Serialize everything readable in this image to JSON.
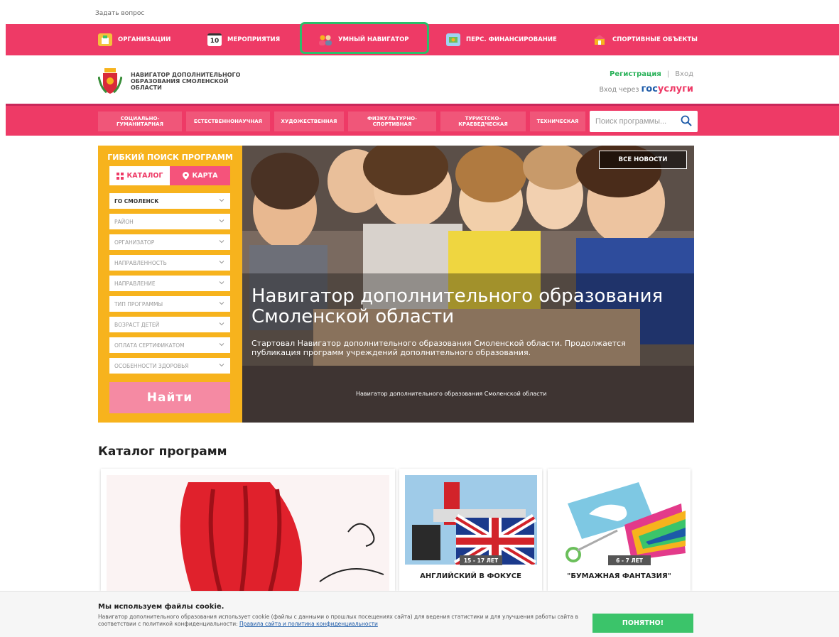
{
  "top_bar": {
    "ask_question": "Задать вопрос"
  },
  "top_nav": {
    "items": [
      {
        "label": "Организации",
        "icon": "building-icon"
      },
      {
        "label": "Мероприятия",
        "icon": "calendar-icon",
        "icon_text": "10"
      },
      {
        "label": "Умный навигатор",
        "icon": "people-icon"
      },
      {
        "label": "Перс. финансирование",
        "icon": "money-icon"
      },
      {
        "label": "Спортивные объекты",
        "icon": "sport-icon"
      }
    ],
    "highlight_color": "#2bbf6a"
  },
  "header": {
    "logo_text": "Навигатор дополнительного образования Смоленской области",
    "register": "Регистрация",
    "separator": "|",
    "login": "Вход",
    "gosuslugi_prefix": "Вход через",
    "gos": "гос",
    "uslugi": "услуги"
  },
  "categories": {
    "items": [
      "Социально-гуманитарная",
      "Естественнонаучная",
      "Художественная",
      "Физкультурно-спортивная",
      "Туристско-краеведческая",
      "Техническая"
    ],
    "search_placeholder": "Поиск программы..."
  },
  "filter": {
    "title": "Гибкий поиск программ",
    "tab_catalog": "Каталог",
    "tab_map": "Карта",
    "selects": [
      "ГО Смоленск",
      "Район",
      "Организатор",
      "Направленность",
      "Направление",
      "Тип программы",
      "Возраст детей",
      "Оплата сертификатом",
      "Особенности здоровья"
    ],
    "find_button": "Найти"
  },
  "hero": {
    "all_news": "Все новости",
    "title": "Навигатор дополнительного образования Смоленской области",
    "description": "Стартовал Навигатор дополнительного образования Смоленской области. Продолжается публикация программ учреждений дополнительного образования.",
    "caption": "Навигатор дополнительного образования Смоленской области"
  },
  "catalog": {
    "title": "Каталог программ",
    "cards": [
      {
        "age": "",
        "title": ""
      },
      {
        "age": "15 - 17 лет",
        "title": "Английский в фокусе"
      },
      {
        "age": "6 - 7 лет",
        "title": "\"Бумажная фантазия\""
      }
    ]
  },
  "cookie": {
    "title": "Мы используем файлы cookie.",
    "text": "Навигатор дополнительного образования использует cookie (файлы с данными о прошлых посещениях сайта) для ведения статистики и для улучшения работы сайта в соответствии с политикой конфиденциальности:",
    "link": "Правила сайта и политика конфиденциальности",
    "button": "Понятно!"
  },
  "colors": {
    "brand_pink": "#ee3a66",
    "filter_yellow": "#f7b31d",
    "accent_green": "#3bc46a",
    "gos_blue": "#1c5aa8"
  }
}
